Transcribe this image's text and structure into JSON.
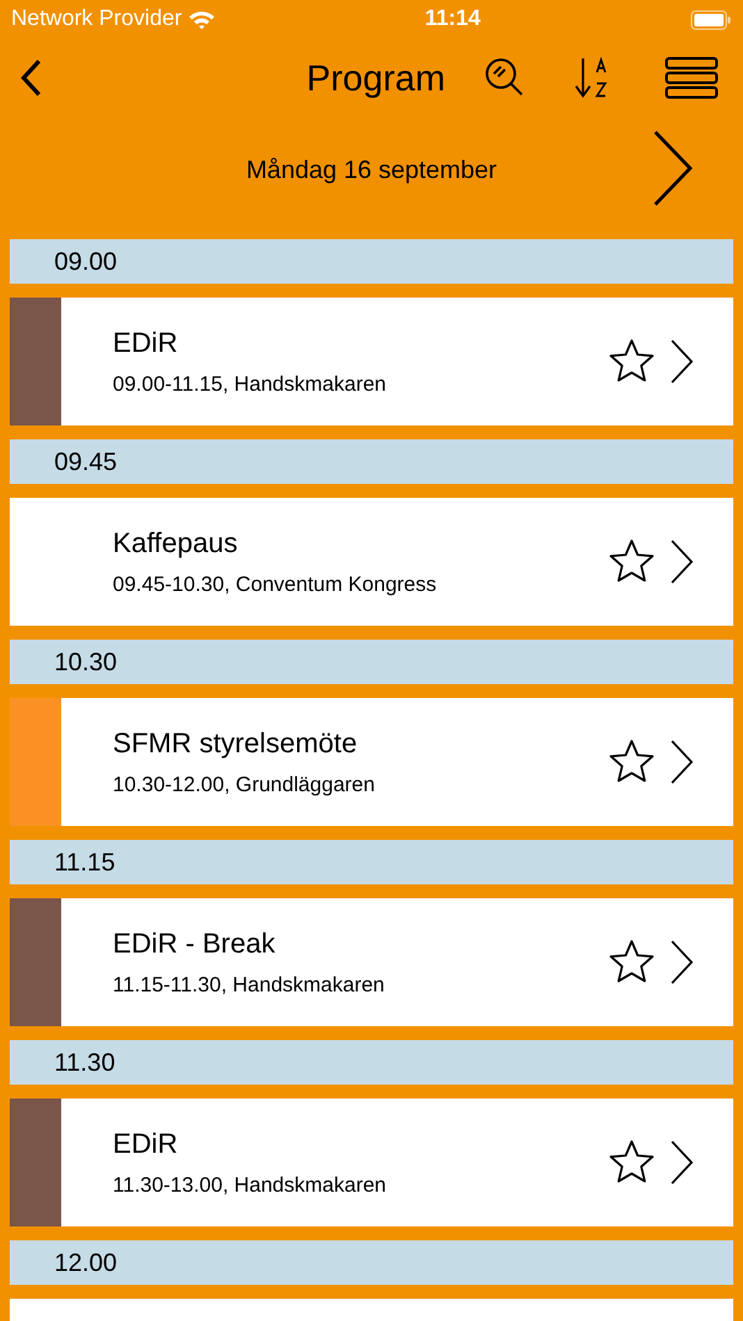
{
  "status_bar": {
    "carrier": "Network Provider",
    "time": "11:14"
  },
  "nav": {
    "title": "Program"
  },
  "date": "Måndag 16 september",
  "sections": [
    {
      "time": "09.00",
      "events": [
        {
          "title": "EDiR",
          "details": "09.00-11.15, Handskmakaren",
          "color": "#79554a",
          "starred": false
        }
      ]
    },
    {
      "time": "09.45",
      "events": [
        {
          "title": "Kaffepaus",
          "details": "09.45-10.30, Conventum Kongress",
          "starred": false
        }
      ]
    },
    {
      "time": "10.30",
      "events": [
        {
          "title": "SFMR styrelsemöte",
          "details": "10.30-12.00, Grundläggaren",
          "color": "#fb9124",
          "starred": false
        }
      ]
    },
    {
      "time": "11.15",
      "events": [
        {
          "title": "EDiR - Break",
          "details": "11.15-11.30, Handskmakaren",
          "color": "#79554a",
          "starred": false
        }
      ]
    },
    {
      "time": "11.30",
      "events": [
        {
          "title": "EDiR",
          "details": "11.30-13.00, Handskmakaren",
          "color": "#79554a",
          "starred": false
        }
      ]
    },
    {
      "time": "12.00"
    }
  ]
}
